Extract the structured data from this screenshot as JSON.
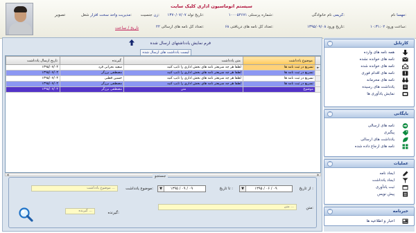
{
  "header": {
    "system_title": "سیستم اتوماسیون اداری کلیک سایت",
    "photo_label": "تصویر",
    "fields": {
      "name_label": "نام:",
      "name_value": "مهسا",
      "family_label": "نام خانوادگی:",
      "family_value": "کریمی",
      "id_label": "شماره پرسنلی:",
      "id_value": "۱۰۰۰۵۴۶۷۱",
      "post_label": "شغل:",
      "post_value": "مدیریت واحد سخت افزار",
      "login_time_label": "ساعت ورود:",
      "login_time_value": "۱۰:۳۱:۰۲",
      "login_date_label": "تاریخ ورود:",
      "login_date_value": "۱۳۹۵/۰۹/۰۸",
      "birth_label": "تاریخ تولد:",
      "birth_value": "۱۳۷۰/۰۷/۰۷",
      "gender_label": "جنسیت:",
      "gender_value": "زن",
      "recv_label": "تعداد کل نامه های دریافتی:",
      "recv_value": "۶۸",
      "sent_label": "تعداد کل نامه های ارسالی:",
      "sent_value": "۲۲"
    },
    "datetime_link": "تاریخ / ساعت"
  },
  "main": {
    "form_title": "فرم نمایش یادداشتهای ارسال شده",
    "tab_label": "لیست یادداشت های ارسال شده",
    "columns": [
      "موضوع یادداشت",
      "متن یادداشت",
      "گیرنده",
      "تاریخ ارسال یادداشت"
    ],
    "rows": [
      {
        "subject": "تسریع در ثبت نامه ها",
        "body": "لطفا هر چه سریعتر نامه های بخش اداری را تایپ کنید",
        "recipient": "سعید بحرانی فرد",
        "date": "۱۳۹۵/۰۷/۰۳"
      },
      {
        "subject": "تسریع در ثبت نامه ها",
        "body": "لطفا هر چه سریعتر نامه های بخش اداری را تایپ کنید",
        "recipient": "مصطفی برزگر",
        "date": "۱۳۹۵/۰۷/۰۳"
      },
      {
        "subject": "تسریع در ثبت نامه ها",
        "body": "لطفا هر چه سریعتر نامه های بخش اداری را تایپ کنید",
        "recipient": "حسین قطبی",
        "date": "۱۳۹۵/۰۷/۰۳"
      },
      {
        "subject": "تسریع در ثبت نامه ها",
        "body": "لطفا هر چه سریعتر نامه های بخش اداری را تایپ کنید",
        "recipient": "مصطفی برزگر",
        "date": "۱۳۹۵/۰۷/۰۳"
      },
      {
        "subject": "موضوع",
        "body": "متن",
        "recipient": "مصطفی برزگر",
        "date": "۱۳۹۵/۰۷/۰۳"
      }
    ],
    "row_indicator": "►",
    "search": {
      "legend": "جستجو",
      "from_date_label": "از تاریخ :",
      "from_date_value": "۱۳۹۵ / ۰۶ / ۰۹",
      "to_date_label": "تا تاریخ :",
      "to_date_value": "۱۳۹۵ / ۰۹ / ۰۹",
      "subject_label": "موضوع یادداشت:",
      "subject_placeholder": "موضوع یادداشت ...",
      "body_label": "متن:",
      "body_placeholder": "متن ...",
      "recipient_label": "گیرنده:",
      "recipient_placeholder": "گیرنده ..."
    }
  },
  "sidebar": {
    "groups": [
      {
        "title": "کارتابل",
        "items": [
          {
            "label": "همه نامه های وارده",
            "icon": "arrow-down-icon"
          },
          {
            "label": "نامه های خوانده نشده",
            "icon": "mail-closed-icon"
          },
          {
            "label": "نامه های خوانده شده",
            "icon": "mail-open-icon"
          },
          {
            "label": "نامه های اقدام فوری",
            "icon": "alert-icon"
          },
          {
            "label": "نامه های محرمانه",
            "icon": "binoculars-icon"
          },
          {
            "label": "یادداشت های رسیده",
            "icon": "notes-icon"
          },
          {
            "label": "نمایش یادآوری ها",
            "icon": "reminder-icon"
          }
        ]
      },
      {
        "title": "بایگانی",
        "items": [
          {
            "label": "نامه های ارسالی",
            "icon": "arrow-right-icon"
          },
          {
            "label": "پیگیری",
            "icon": "tag-icon"
          },
          {
            "label": "یادداشت های ارسالی",
            "icon": "leaf-icon"
          },
          {
            "label": "نامه های ارجاع داده شده",
            "icon": "grid-icon"
          }
        ]
      },
      {
        "title": "عملیات",
        "items": [
          {
            "label": "ایجاد نامه",
            "icon": "pen-icon"
          },
          {
            "label": "ایجاد یادداشت",
            "icon": "cup-icon"
          },
          {
            "label": "ثبت یادآوری",
            "icon": "calendar-icon"
          },
          {
            "label": "پیش نویس",
            "icon": "document-icon"
          }
        ]
      },
      {
        "title": "خبرنامه",
        "items": [
          {
            "label": "اخبار و اطلاعیه ها",
            "icon": "news-icon"
          }
        ]
      }
    ]
  }
}
